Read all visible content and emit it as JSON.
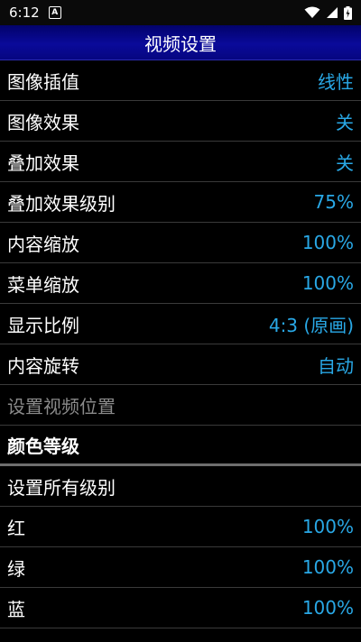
{
  "status_bar": {
    "time": "6:12",
    "badge": "A"
  },
  "header": {
    "title": "视频设置"
  },
  "settings": [
    {
      "label": "图像插值",
      "value": "线性"
    },
    {
      "label": "图像效果",
      "value": "关"
    },
    {
      "label": "叠加效果",
      "value": "关"
    },
    {
      "label": "叠加效果级别",
      "value": "75%"
    },
    {
      "label": "内容缩放",
      "value": "100%"
    },
    {
      "label": "菜单缩放",
      "value": "100%"
    },
    {
      "label": "显示比例",
      "value": "4:3 (原画)"
    },
    {
      "label": "内容旋转",
      "value": "自动"
    },
    {
      "label": "设置视频位置",
      "value": ""
    }
  ],
  "color_section": {
    "title": "颜色等级"
  },
  "color_levels": [
    {
      "label": "设置所有级别",
      "value": ""
    },
    {
      "label": "红",
      "value": "100%"
    },
    {
      "label": "绿",
      "value": "100%"
    },
    {
      "label": "蓝",
      "value": "100%"
    }
  ],
  "colors": {
    "accent": "#29a8e6",
    "header": "#0a0a9a",
    "background": "#000000"
  }
}
